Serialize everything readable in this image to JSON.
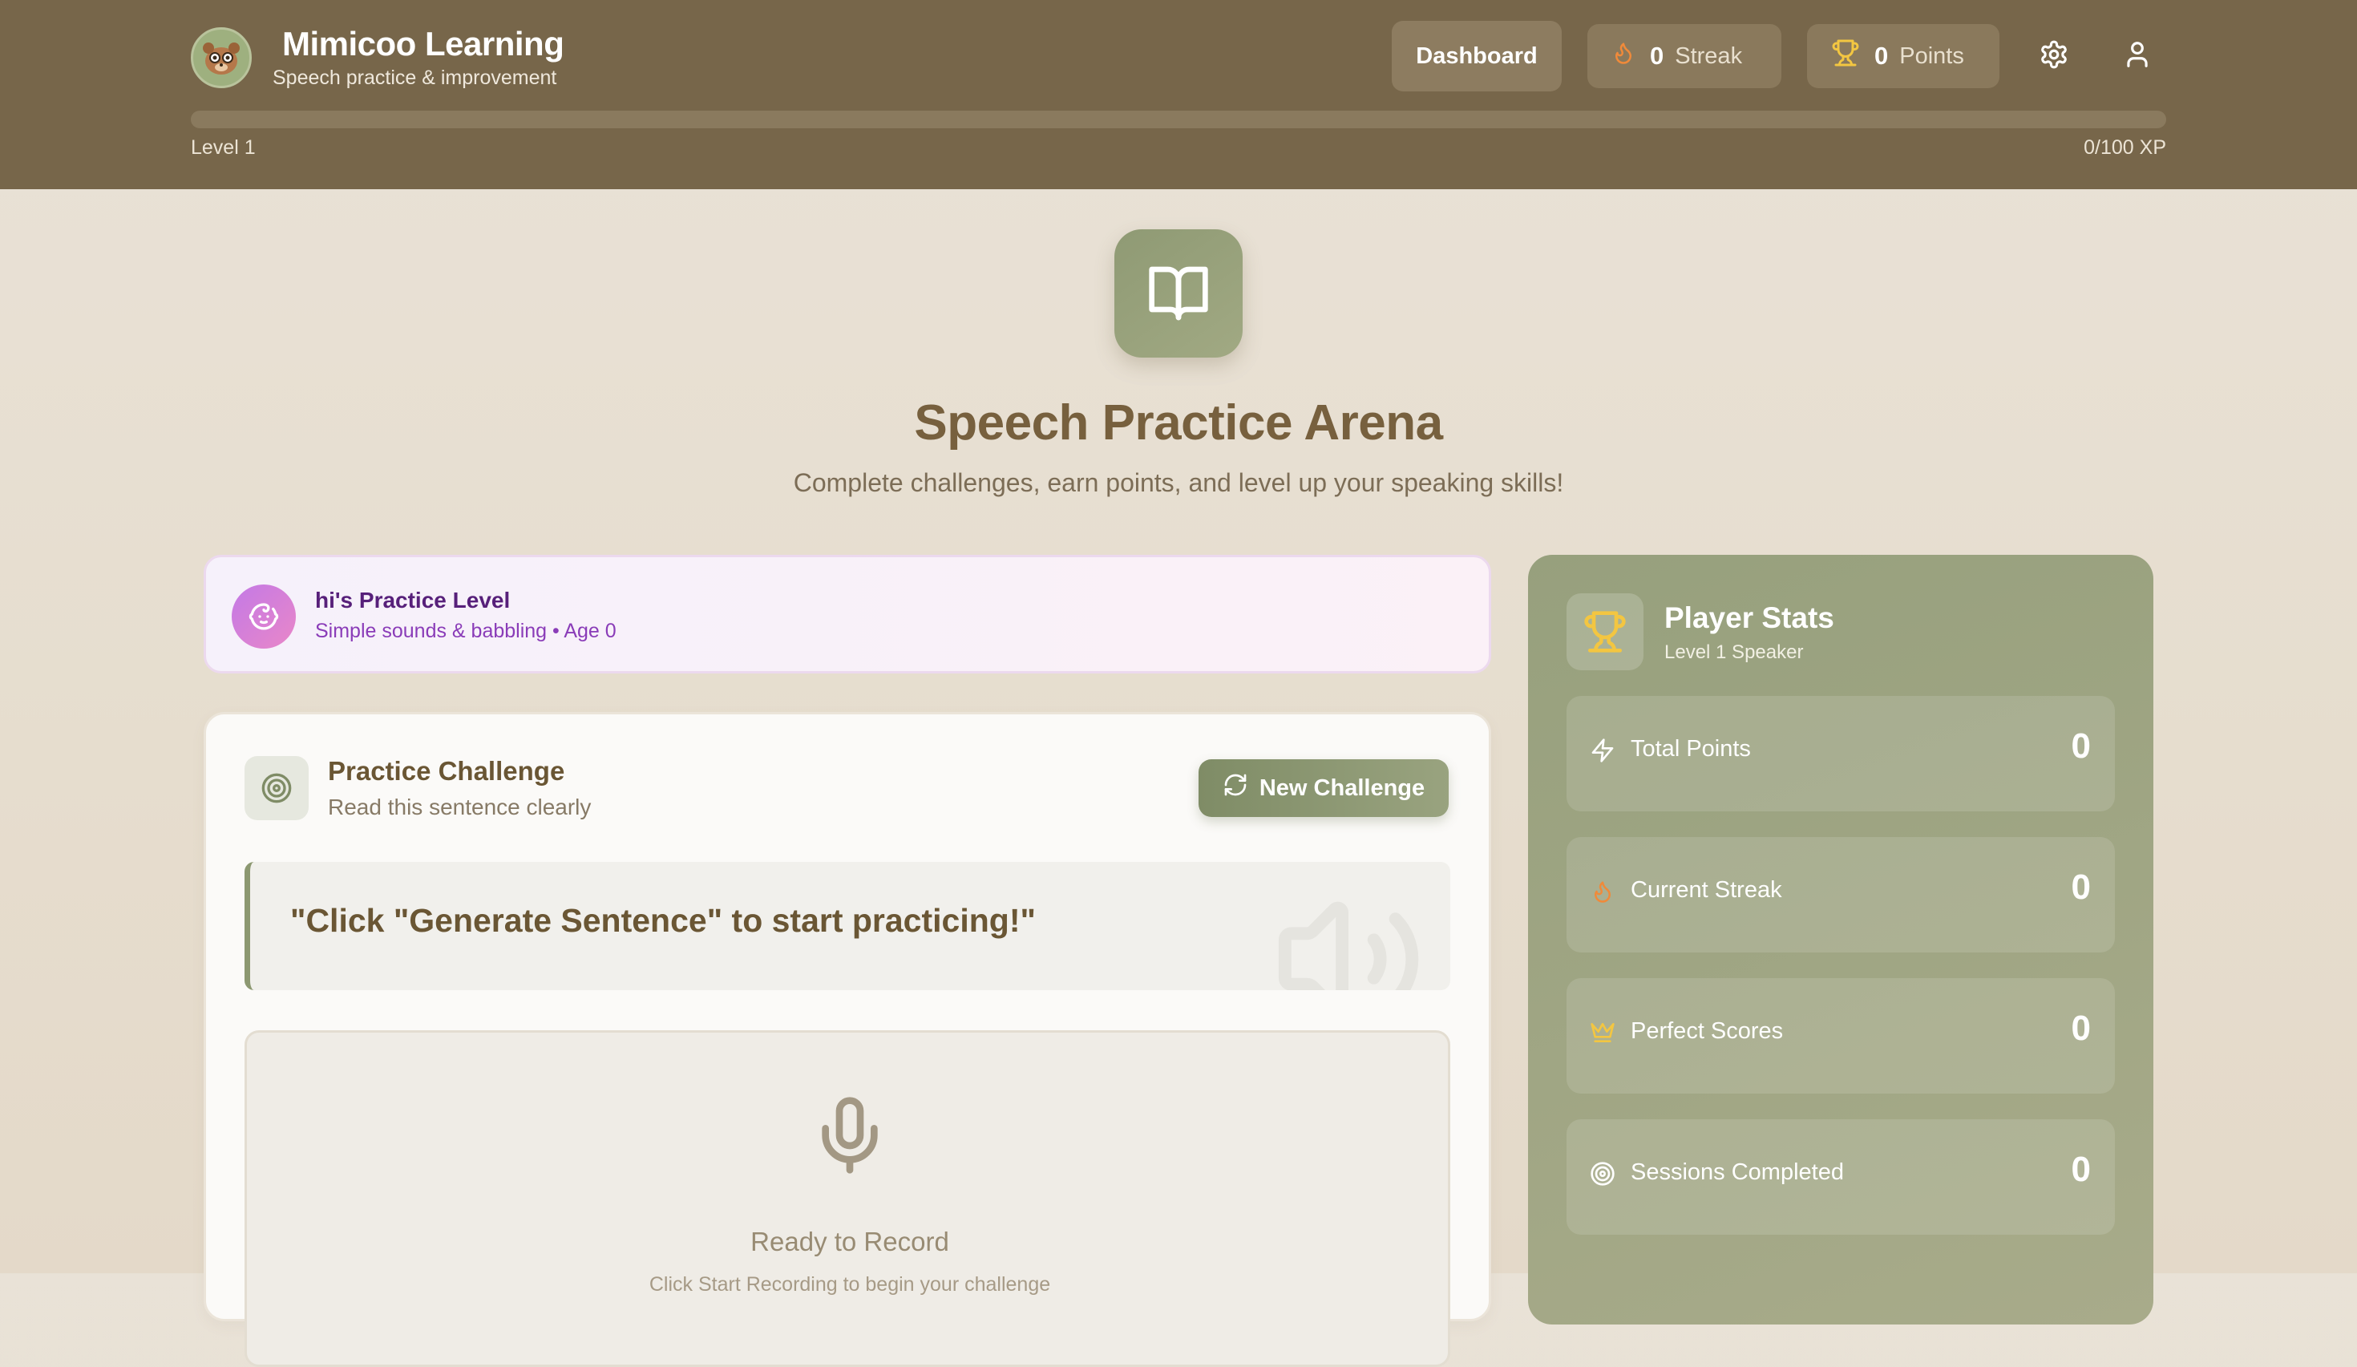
{
  "header": {
    "brand_title": "Mimicoo Learning",
    "brand_subtitle": "Speech practice & improvement",
    "dashboard_label": "Dashboard",
    "streak_value": "0",
    "streak_label": "Streak",
    "points_value": "0",
    "points_label": "Points",
    "level_label": "Level 1",
    "xp_label": "0/100 XP",
    "xp_progress": 0
  },
  "hero": {
    "title": "Speech Practice Arena",
    "subtitle": "Complete challenges, earn points, and level up your speaking skills!"
  },
  "practice_level": {
    "title": "hi's Practice Level",
    "description": "Simple sounds & babbling • Age 0"
  },
  "challenge": {
    "title": "Practice Challenge",
    "subtitle": "Read this sentence clearly",
    "new_button": "New Challenge",
    "sentence": "\"Click \"Generate Sentence\" to start practicing!\"",
    "record_title": "Ready to Record",
    "record_hint": "Click Start Recording to begin your challenge"
  },
  "stats": {
    "title": "Player Stats",
    "subtitle": "Level 1 Speaker",
    "items": [
      {
        "label": "Total Points",
        "value": "0",
        "icon": "lightning-icon"
      },
      {
        "label": "Current Streak",
        "value": "0",
        "icon": "flame-icon"
      },
      {
        "label": "Perfect Scores",
        "value": "0",
        "icon": "crown-icon"
      },
      {
        "label": "Sessions Completed",
        "value": "0",
        "icon": "target-icon"
      }
    ]
  },
  "colors": {
    "header_bg": "#77664a",
    "accent_green": "#8f9a74",
    "flame": "#f08a3a",
    "trophy": "#f3c641"
  }
}
